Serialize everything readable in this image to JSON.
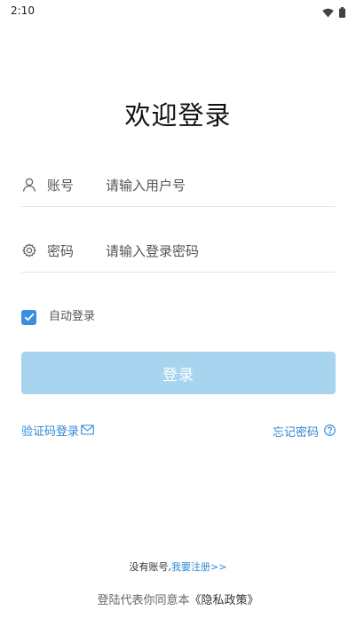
{
  "status_bar": {
    "time": "2:10",
    "icons": [
      "wifi-icon",
      "battery-icon"
    ]
  },
  "title": "欢迎登录",
  "account": {
    "label": "账号",
    "placeholder": "请输入用户号",
    "value": "",
    "icon": "user-icon"
  },
  "password": {
    "label": "密码",
    "placeholder": "请输入登录密码",
    "value": "",
    "icon": "gear-icon"
  },
  "remember": {
    "label": "自动登录",
    "checked": true
  },
  "login_button": {
    "label": "登录"
  },
  "sms_login": {
    "label": "验证码登录",
    "icon": "mail-icon"
  },
  "forgot_password": {
    "label": "忘记密码",
    "icon": "help-circle-icon"
  },
  "register": {
    "prefix": "没有账号,",
    "link": "我要注册>>"
  },
  "policy": {
    "prefix": "登陆代表你同意本",
    "link": "《隐私政策》"
  },
  "colors": {
    "accent": "#2e88d5",
    "checkbox": "#3c8ee0",
    "button_disabled": "#a9d4ef"
  }
}
